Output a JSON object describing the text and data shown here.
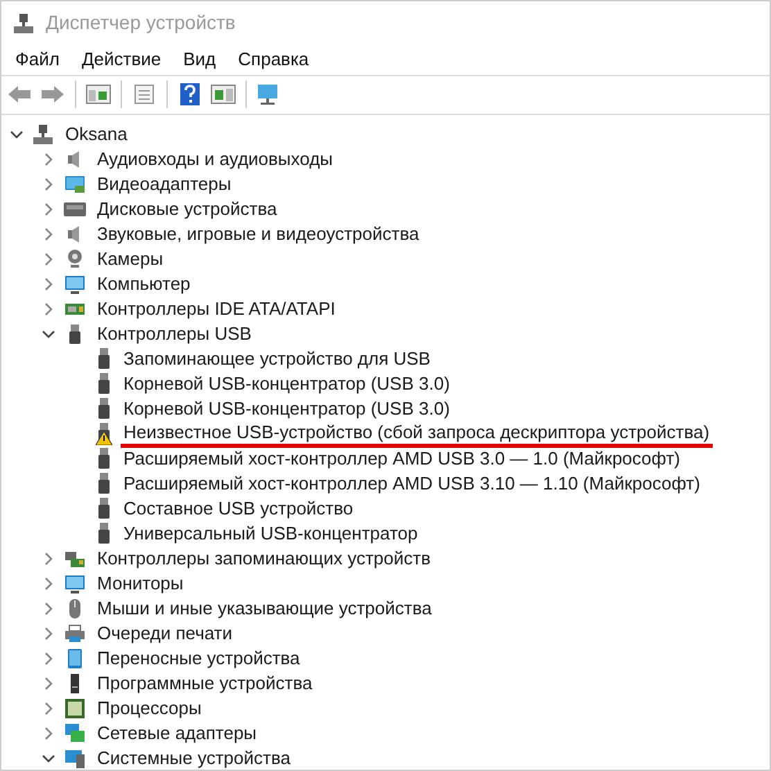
{
  "window": {
    "title": "Диспетчер устройств"
  },
  "menu": [
    "Файл",
    "Действие",
    "Вид",
    "Справка"
  ],
  "tree": {
    "label": "Oksana",
    "expanded": true,
    "children": [
      {
        "label": "Аудиовходы и аудиовыходы",
        "expanded": false
      },
      {
        "label": "Видеоадаптеры",
        "expanded": false
      },
      {
        "label": "Дисковые устройства",
        "expanded": false
      },
      {
        "label": "Звуковые, игровые и видеоустройства",
        "expanded": false
      },
      {
        "label": "Камеры",
        "expanded": false
      },
      {
        "label": "Компьютер",
        "expanded": false
      },
      {
        "label": "Контроллеры IDE ATA/ATAPI",
        "expanded": false
      },
      {
        "label": "Контроллеры USB",
        "expanded": true,
        "children": [
          {
            "label": "Запоминающее устройство для USB",
            "warning": false,
            "underlined": false
          },
          {
            "label": "Корневой USB-концентратор (USB 3.0)",
            "warning": false,
            "underlined": false
          },
          {
            "label": "Корневой USB-концентратор (USB 3.0)",
            "warning": false,
            "underlined": false
          },
          {
            "label": "Неизвестное USB-устройство (сбой запроса дескриптора устройства)",
            "warning": true,
            "underlined": true
          },
          {
            "label": "Расширяемый хост-контроллер AMD USB 3.0 — 1.0 (Майкрософт)",
            "warning": false,
            "underlined": false
          },
          {
            "label": "Расширяемый хост-контроллер AMD USB 3.10 — 1.10 (Майкрософт)",
            "warning": false,
            "underlined": false
          },
          {
            "label": "Составное USB устройство",
            "warning": false,
            "underlined": false
          },
          {
            "label": "Универсальный USB-концентратор",
            "warning": false,
            "underlined": false
          }
        ]
      },
      {
        "label": "Контроллеры запоминающих устройств",
        "expanded": false
      },
      {
        "label": "Мониторы",
        "expanded": false
      },
      {
        "label": "Мыши и иные указывающие устройства",
        "expanded": false
      },
      {
        "label": "Очереди печати",
        "expanded": false
      },
      {
        "label": "Переносные устройства",
        "expanded": false
      },
      {
        "label": "Программные устройства",
        "expanded": false
      },
      {
        "label": "Процессоры",
        "expanded": false
      },
      {
        "label": "Сетевые адаптеры",
        "expanded": false
      },
      {
        "label": "Системные устройства",
        "expanded": true
      }
    ]
  }
}
